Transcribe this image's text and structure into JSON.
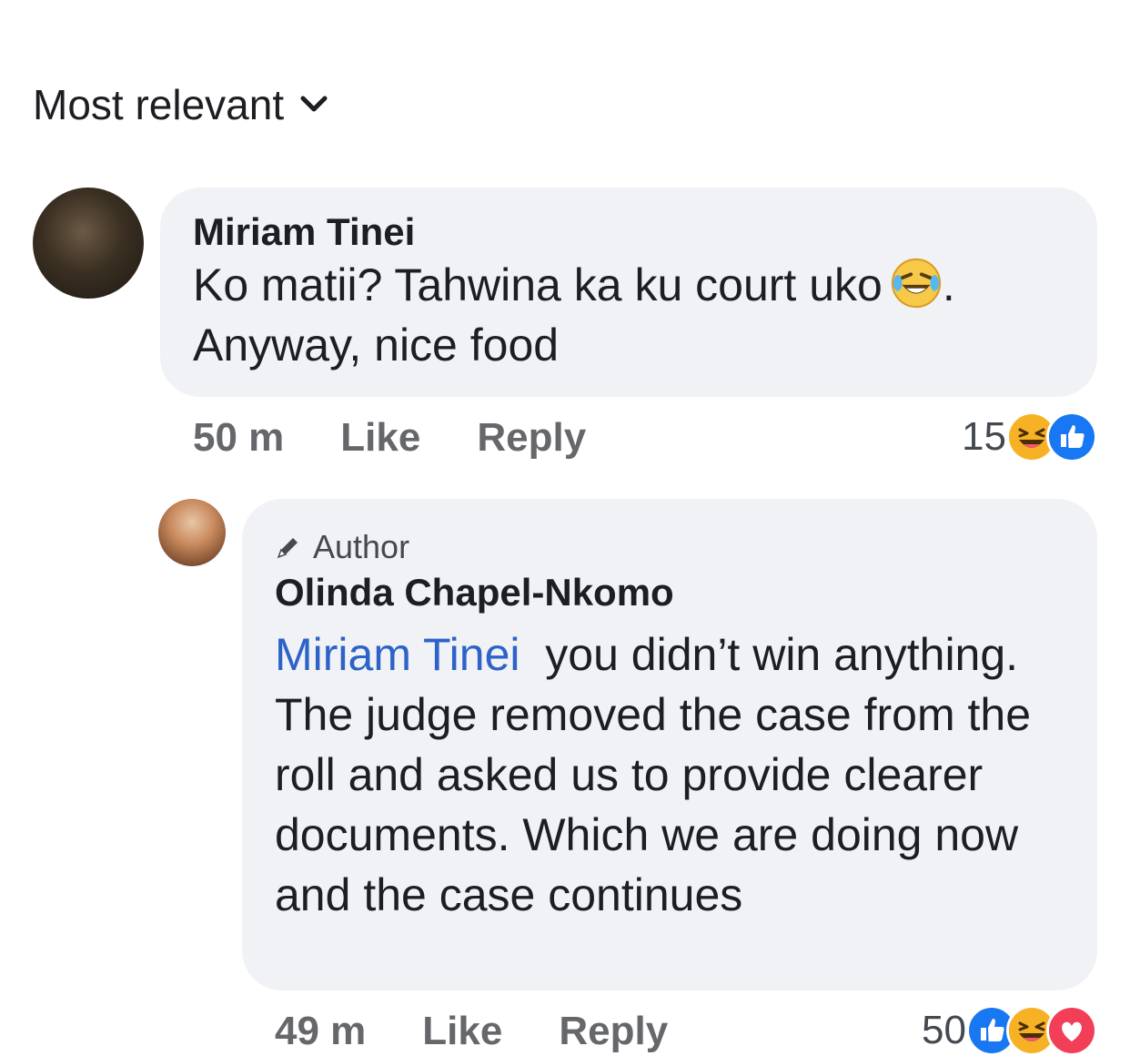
{
  "sort": {
    "label": "Most relevant"
  },
  "comments": [
    {
      "author": "Miriam Tinei",
      "text_line1": "Ko matii? Tahwina ka ku court uko",
      "text_after_emoji": ".",
      "text_line2": "Anyway, nice food",
      "inline_emoji": "laughing-tears-emoji",
      "time": "50 m",
      "like_label": "Like",
      "reply_label": "Reply",
      "reaction_count": "15",
      "reactions": [
        "haha",
        "like"
      ]
    },
    {
      "badge": "Author",
      "author": "Olinda Chapel-Nkomo",
      "mention": "Miriam Tinei",
      "text": "you didn’t win anything. The judge removed the case from the roll and asked us to provide clearer documents. Which we are doing now and the case continues",
      "time": "49 m",
      "like_label": "Like",
      "reply_label": "Reply",
      "reaction_count": "50",
      "reactions": [
        "like",
        "haha",
        "love"
      ]
    }
  ],
  "colors": {
    "bubble": "#f0f2f5",
    "mention": "#2d63c8",
    "meta": "#65676b",
    "like_blue": "#1877f2",
    "love_red": "#f33e58",
    "haha_yellow": "#f7b125"
  }
}
